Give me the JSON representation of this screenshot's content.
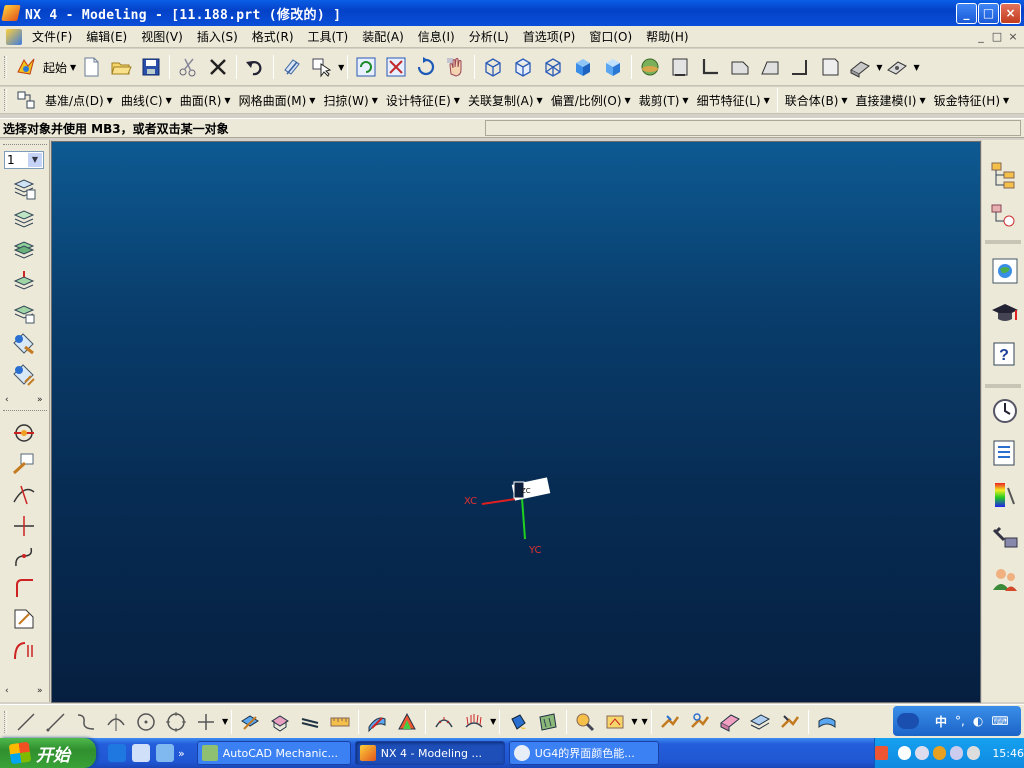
{
  "window": {
    "title": "NX 4 - Modeling - [11.188.prt  (修改的) ]",
    "controls": [
      "_",
      "□",
      "×"
    ]
  },
  "menubar": {
    "items": [
      "文件(F)",
      "编辑(E)",
      "视图(V)",
      "插入(S)",
      "格式(R)",
      "工具(T)",
      "装配(A)",
      "信息(I)",
      "分析(L)",
      "首选项(P)",
      "窗口(O)",
      "帮助(H)"
    ],
    "doc_controls": [
      "_",
      "□",
      "×"
    ]
  },
  "toolbar_standard": {
    "start_label": "起始"
  },
  "toolbar_features": {
    "items": [
      "基准/点(D)",
      "曲线(C)",
      "曲面(R)",
      "网格曲面(M)",
      "扫掠(W)",
      "设计特征(E)",
      "关联复制(A)",
      "偏置/比例(O)",
      "裁剪(T)",
      "细节特征(L)",
      "联合体(B)",
      "直接建模(I)",
      "钣金特征(H)"
    ]
  },
  "status": {
    "prompt": "选择对象并使用 MB3，或者双击某一对象"
  },
  "left_palette": {
    "layer_value": "1"
  },
  "graphics": {
    "background_top": "#0d5a92",
    "background_bottom": "#061f40",
    "wcs": {
      "x_label": "XC",
      "y_label": "YC",
      "z_label": "ZC"
    }
  },
  "taskbar": {
    "start_label": "开始",
    "tasks": [
      {
        "label": "AutoCAD Mechanic...",
        "active": false
      },
      {
        "label": "NX 4 - Modeling ...",
        "active": true
      },
      {
        "label": "UG4的界面颜色能...",
        "active": false
      }
    ],
    "clock": "15:46",
    "ime_label": "中"
  }
}
